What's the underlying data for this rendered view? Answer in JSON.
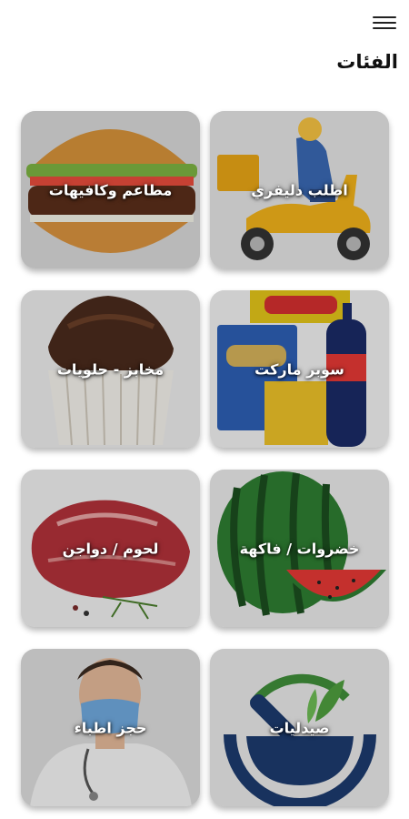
{
  "header": {
    "menu_icon": "hamburger-menu-icon",
    "title": "الفئات"
  },
  "categories": [
    {
      "label": "اطلب دليفري",
      "image": "delivery-scooter-image"
    },
    {
      "label": "مطاعم وكافيهات",
      "image": "burger-image"
    },
    {
      "label": "سوبر ماركت",
      "image": "grocery-products-image"
    },
    {
      "label": "مخابز - حلويات",
      "image": "cupcake-image"
    },
    {
      "label": "خضروات / فاكهة",
      "image": "watermelon-image"
    },
    {
      "label": "لحوم / دواجن",
      "image": "raw-meat-image"
    },
    {
      "label": "صيدليات",
      "image": "pharmacy-mortar-image"
    },
    {
      "label": "حجز اطباء",
      "image": "doctor-image"
    }
  ]
}
